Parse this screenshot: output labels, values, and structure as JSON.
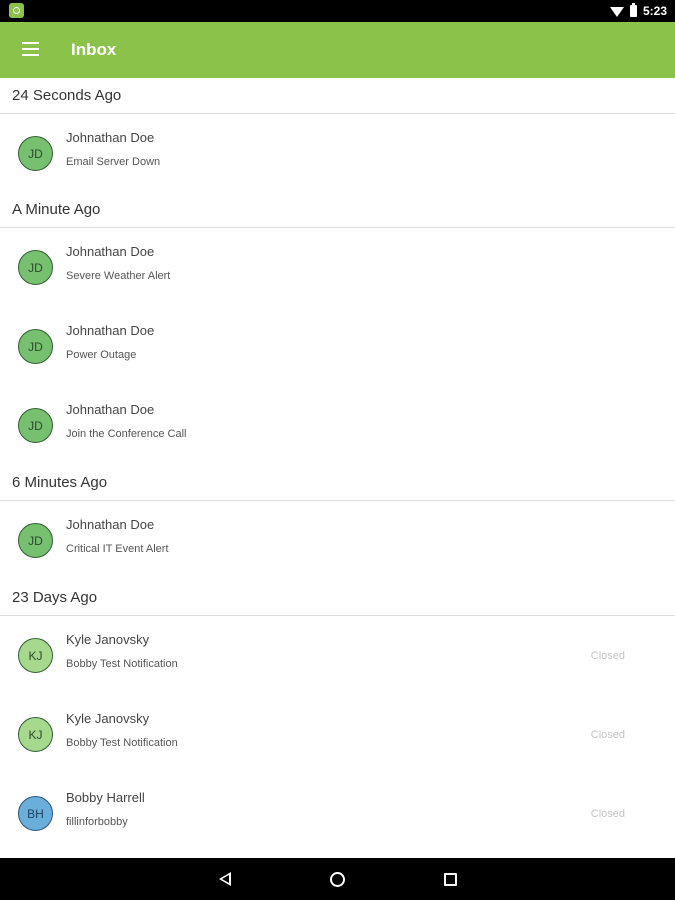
{
  "status_bar": {
    "time": "5:23",
    "app_icon": "app-notification-icon",
    "wifi_icon": "wifi-icon",
    "battery_icon": "battery-icon"
  },
  "app_bar": {
    "title": "Inbox",
    "menu_icon": "menu-icon"
  },
  "colors": {
    "accent": "#8bc34a",
    "avatar_green": "#76c06f",
    "avatar_light_green": "#a6d88d",
    "avatar_blue": "#6aaedc",
    "status_text": "#c4c4c4"
  },
  "sections": [
    {
      "header": "24 Seconds Ago",
      "items": [
        {
          "initials": "JD",
          "name": "Johnathan Doe",
          "subject": "Email Server Down",
          "status": ""
        }
      ]
    },
    {
      "header": "A Minute Ago",
      "items": [
        {
          "initials": "JD",
          "name": "Johnathan Doe",
          "subject": "Severe Weather Alert",
          "status": ""
        },
        {
          "initials": "JD",
          "name": "Johnathan Doe",
          "subject": "Power Outage",
          "status": ""
        },
        {
          "initials": "JD",
          "name": "Johnathan Doe",
          "subject": "Join the Conference Call",
          "status": ""
        }
      ]
    },
    {
      "header": "6 Minutes Ago",
      "items": [
        {
          "initials": "JD",
          "name": "Johnathan Doe",
          "subject": "Critical IT Event Alert",
          "status": ""
        }
      ]
    },
    {
      "header": "23 Days Ago",
      "items": [
        {
          "initials": "KJ",
          "name": "Kyle Janovsky",
          "subject": "Bobby Test Notification",
          "status": "Closed"
        },
        {
          "initials": "KJ",
          "name": "Kyle Janovsky",
          "subject": "Bobby Test Notification",
          "status": "Closed"
        },
        {
          "initials": "BH",
          "name": "Bobby Harrell",
          "subject": "fillinforbobby",
          "status": "Closed"
        }
      ]
    }
  ],
  "nav_bar": {
    "back_icon": "back-icon",
    "home_icon": "home-icon",
    "recents_icon": "recents-icon"
  }
}
